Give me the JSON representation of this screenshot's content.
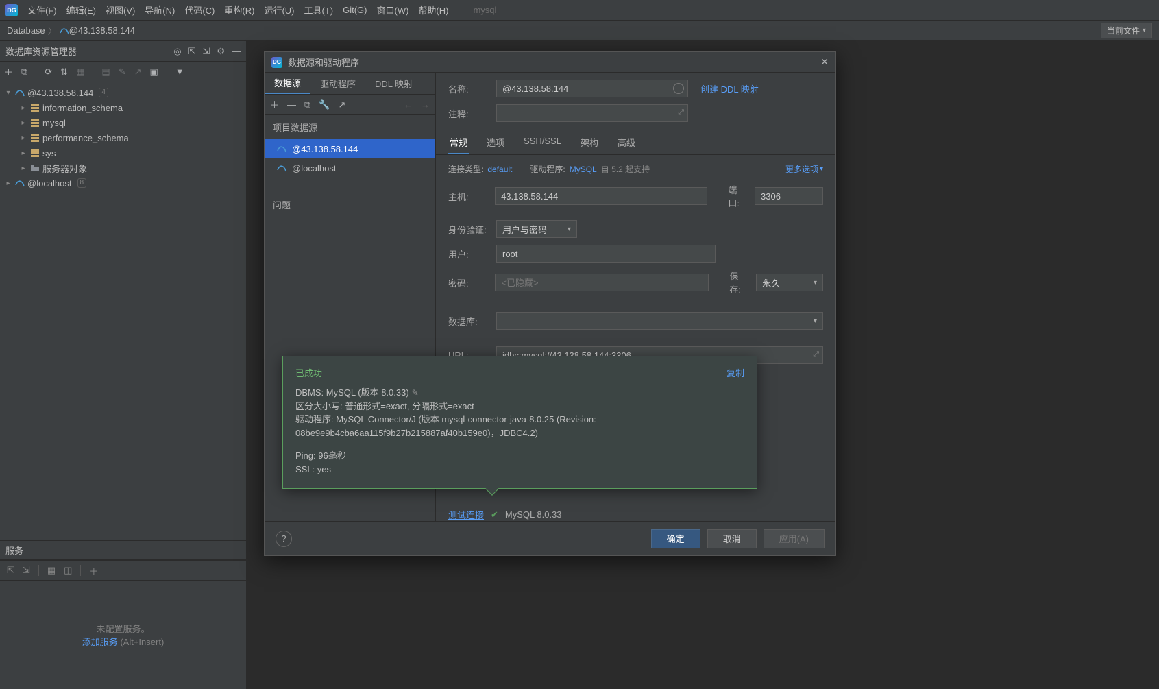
{
  "menu": {
    "file": "文件(F)",
    "edit": "编辑(E)",
    "view": "视图(V)",
    "navigate": "导航(N)",
    "code": "代码(C)",
    "refactor": "重构(R)",
    "run": "运行(U)",
    "tools": "工具(T)",
    "git": "Git(G)",
    "window": "窗口(W)",
    "help": "帮助(H)",
    "search": "mysql"
  },
  "breadcrumb": {
    "root": "Database",
    "ds": "@43.138.58.144",
    "current_file": "当前文件"
  },
  "explorer": {
    "title": "数据库资源管理器",
    "ds1": "@43.138.58.144",
    "ds1_count": "4",
    "schemas": {
      "info": "information_schema",
      "mysql": "mysql",
      "perf": "performance_schema",
      "sys": "sys"
    },
    "server_objects": "服务器对象",
    "ds2": "@localhost",
    "ds2_count": "8"
  },
  "services": {
    "title": "服务",
    "msg": "未配置服务。",
    "add": "添加服务",
    "hint": "(Alt+Insert)"
  },
  "dialog": {
    "title": "数据源和驱动程序",
    "left_tabs": {
      "ds": "数据源",
      "drv": "驱动程序",
      "ddl": "DDL 映射"
    },
    "section": "项目数据源",
    "items": {
      "a": "@43.138.58.144",
      "b": "@localhost"
    },
    "problems": "问题",
    "labels": {
      "name": "名称:",
      "comment": "注释:",
      "host": "主机:",
      "port": "端口:",
      "auth": "身份验证:",
      "user": "用户:",
      "password": "密码:",
      "save": "保存:",
      "database": "数据库:",
      "url": "URL:"
    },
    "values": {
      "name": "@43.138.58.144",
      "host": "43.138.58.144",
      "port": "3306",
      "auth": "用户与密码",
      "user": "root",
      "password_hint": "<已隐藏>",
      "save": "永久",
      "url": "jdbc:mysql://43.138.58.144:3306"
    },
    "ddl_link": "创建 DDL 映射",
    "inner_tabs": {
      "general": "常规",
      "options": "选项",
      "ssh": "SSH/SSL",
      "schemas": "架构",
      "advanced": "高级"
    },
    "info": {
      "conn_type_k": "连接类型:",
      "conn_type_v": "default",
      "driver_k": "驱动程序:",
      "driver_v": "MySQL",
      "driver_note": "自 5.2 起支持",
      "more": "更多选项"
    },
    "test": {
      "link": "测试连接",
      "version": "MySQL 8.0.33"
    },
    "buttons": {
      "ok": "确定",
      "cancel": "取消",
      "apply": "应用(A)"
    }
  },
  "popup": {
    "title": "已成功",
    "copy": "复制",
    "l1": "DBMS: MySQL (版本 8.0.33)",
    "l2": "区分大小写: 普通形式=exact, 分隔形式=exact",
    "l3": "驱动程序: MySQL Connector/J (版本 mysql-connector-java-8.0.25 (Revision: 08be9e9b4cba6aa115f9b27b215887af40b159e0)，JDBC4.2)",
    "l4": "Ping: 96毫秒",
    "l5": "SSL: yes"
  }
}
